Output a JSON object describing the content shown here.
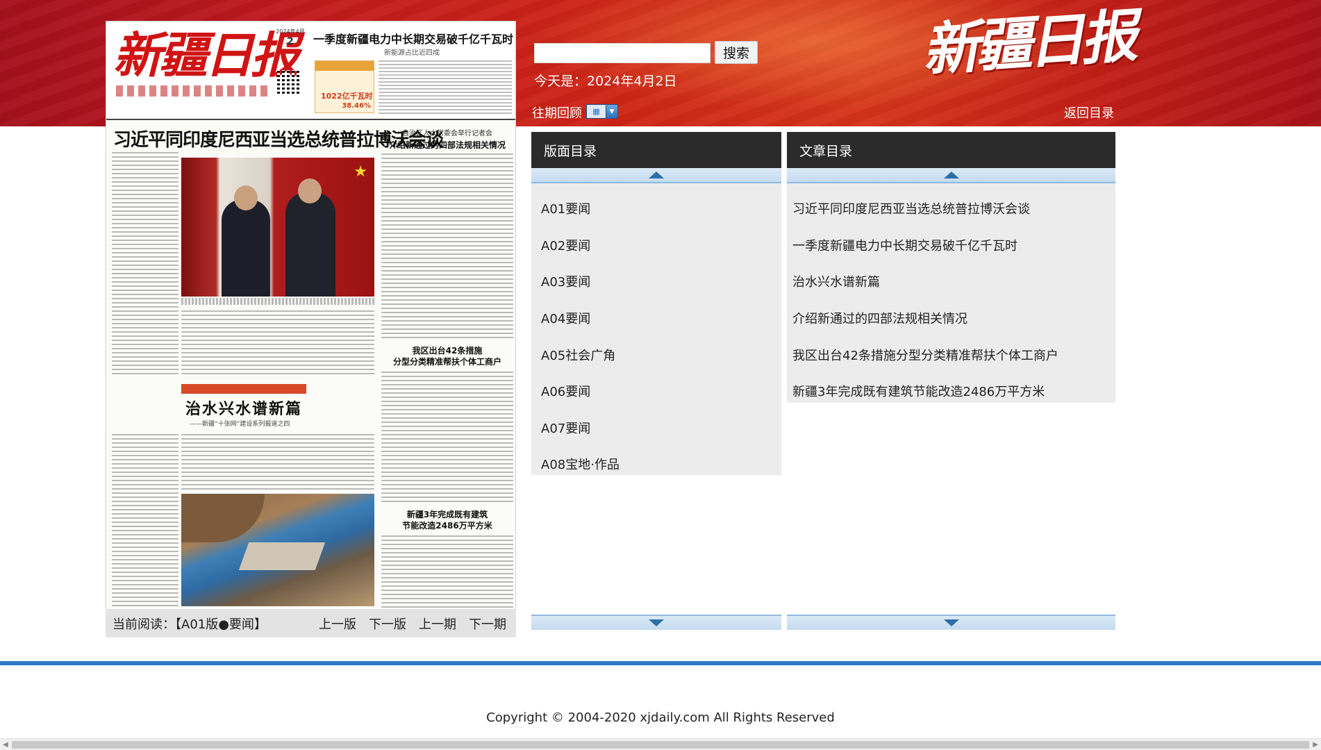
{
  "header": {
    "logo_text": "新疆日报",
    "search_button": "搜索",
    "search_value": "",
    "today_label": "今天是：2024年4月2日",
    "past_issues_label": "往期回顾",
    "return_link": "返回目录"
  },
  "newspaper": {
    "masthead_logo": "新疆日报",
    "masthead_date_line": "2024年4月",
    "masthead_day": "2",
    "masthead_headline": "一季度新疆电力中长期交易破千亿千瓦时",
    "masthead_headline_sub": "新能源占比近四成",
    "masthead_ad_number": "1022亿千瓦时",
    "masthead_ad_percent": "38.46%",
    "headline_main": "习近平同印度尼西亚当选总统普拉博沃会谈",
    "right_head1_small": "自治区人大常委会举行记者会",
    "right_head1": "介绍新通过的四部法规相关情况",
    "right_head2_a": "我区出台42条措施",
    "right_head2_b": "分型分类精准帮扶个体工商户",
    "banner2_label": "治水兴水谱新篇",
    "head2": "治水兴水谱新篇",
    "head2_sub": "——新疆“十张网”建设系列报道之四",
    "right_head3_a": "新疆3年完成既有建筑",
    "right_head3_b": "节能改造2486万平方米"
  },
  "reading_bar": {
    "current": "当前阅读：【A01版●要闻】",
    "prev_page": "上一版",
    "next_page": "下一版",
    "prev_issue": "上一期",
    "next_issue": "下一期"
  },
  "layout_panel": {
    "title": "版面目录",
    "items": [
      "A01要闻",
      "A02要闻",
      "A03要闻",
      "A04要闻",
      "A05社会广角",
      "A06要闻",
      "A07要闻",
      "A08宝地·作品"
    ]
  },
  "article_panel": {
    "title": "文章目录",
    "items": [
      "习近平同印度尼西亚当选总统普拉博沃会谈",
      "一季度新疆电力中长期交易破千亿千瓦时",
      "治水兴水谱新篇",
      "介绍新通过的四部法规相关情况",
      "我区出台42条措施分型分类精准帮扶个体工商户",
      "新疆3年完成既有建筑节能改造2486万平方米"
    ]
  },
  "footer": {
    "copyright": "Copyright © 2004-2020 xjdaily.com All Rights Reserved"
  },
  "colors": {
    "banner_red": "#c01a1d",
    "panel_header": "#2b2b2b",
    "panel_bg": "#ececec",
    "footer_line": "#2e78c8"
  }
}
